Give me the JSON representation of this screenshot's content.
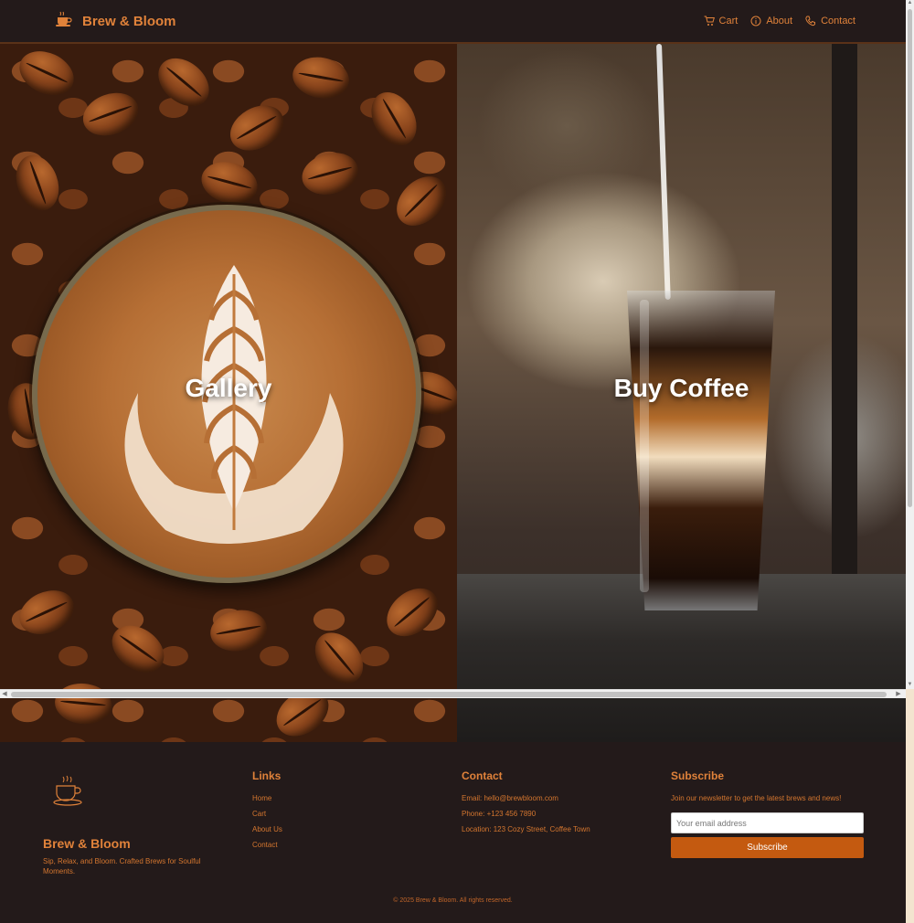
{
  "header": {
    "brand": "Brew & Bloom",
    "nav": [
      {
        "label": "Cart",
        "icon": "cart-icon"
      },
      {
        "label": "About",
        "icon": "info-icon"
      },
      {
        "label": "Contact",
        "icon": "phone-icon"
      }
    ]
  },
  "hero": {
    "left_title": "Gallery",
    "right_title": "Buy Coffee"
  },
  "footer": {
    "brand": "Brew & Bloom",
    "tagline": "Sip, Relax, and Bloom. Crafted Brews for Soulful Moments.",
    "links_heading": "Links",
    "links": [
      "Home",
      "Cart",
      "About Us",
      "Contact"
    ],
    "contact_heading": "Contact",
    "contact": {
      "email": "Email: hello@brewbloom.com",
      "phone": "Phone: +123 456 7890",
      "location": "Location: 123 Cozy Street, Coffee Town"
    },
    "subscribe_heading": "Subscribe",
    "subscribe_text": "Join our newsletter to get the latest brews and news!",
    "email_placeholder": "Your email address",
    "subscribe_button": "Subscribe",
    "copyright": "© 2025 Brew & Bloom. All rights reserved."
  },
  "colors": {
    "header_bg": "#231a1a",
    "accent": "#e0823a",
    "button": "#c45a10"
  }
}
